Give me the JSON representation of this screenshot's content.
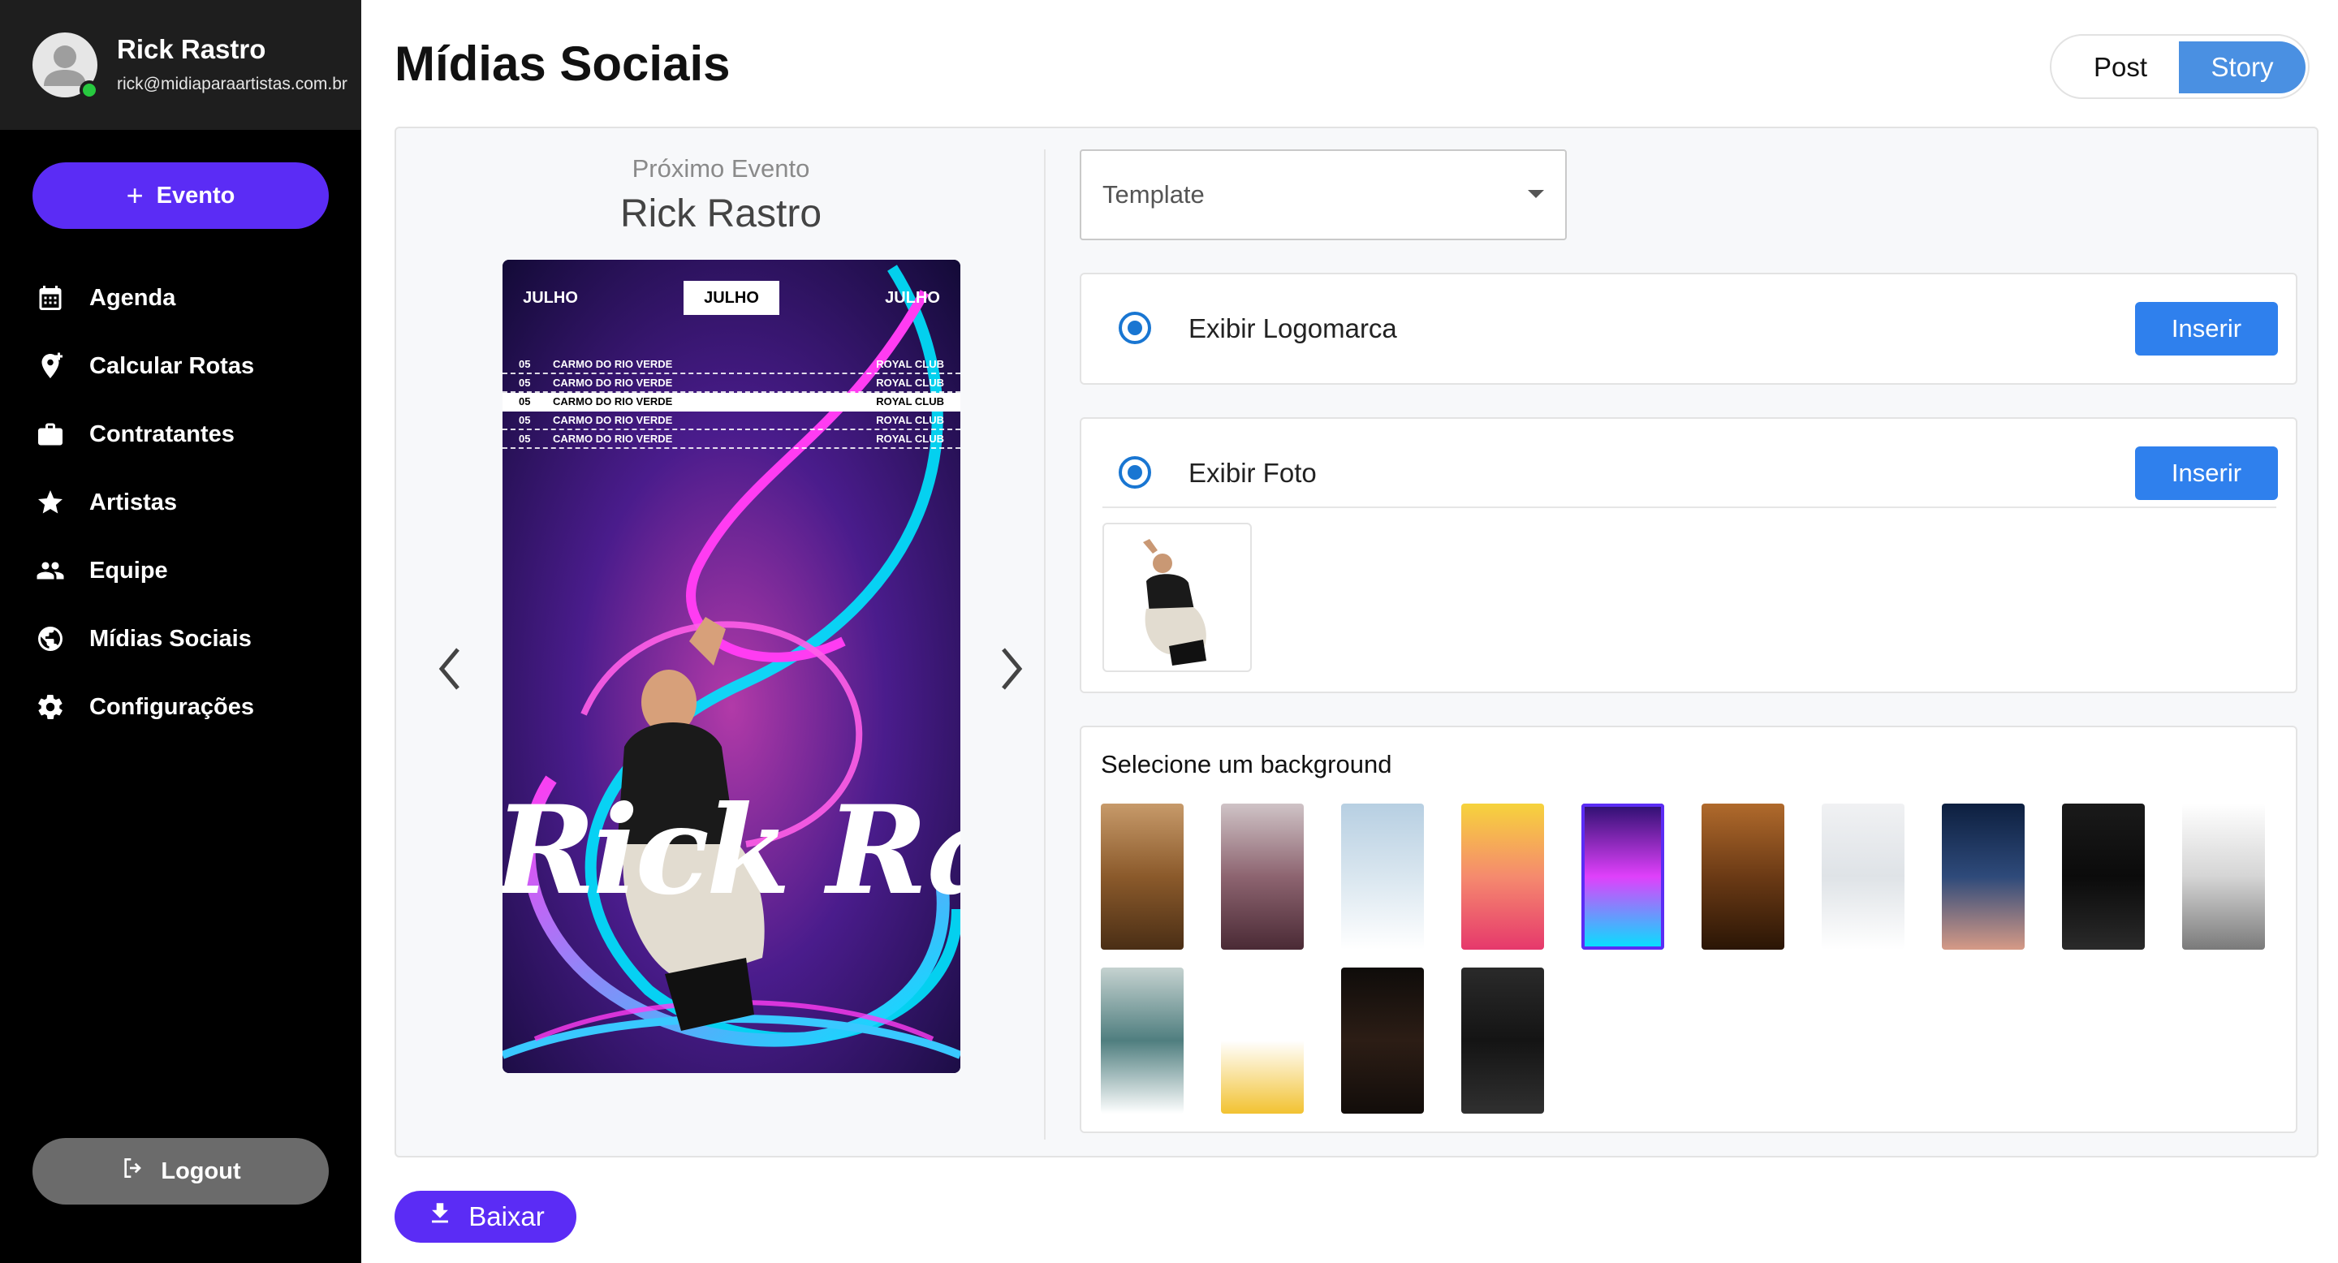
{
  "profile": {
    "name": "Rick Rastro",
    "email": "rick@midiaparaartistas.com.br",
    "status_color": "#27c93f"
  },
  "sidebar": {
    "event_button": {
      "icon": "plus-icon",
      "label": "Evento"
    },
    "items": [
      {
        "icon": "calendar-icon",
        "label": "Agenda"
      },
      {
        "icon": "location-plus-icon",
        "label": "Calcular Rotas"
      },
      {
        "icon": "briefcase-icon",
        "label": "Contratantes"
      },
      {
        "icon": "star-icon",
        "label": "Artistas"
      },
      {
        "icon": "people-icon",
        "label": "Equipe"
      },
      {
        "icon": "globe-icon",
        "label": "Mídias Sociais"
      },
      {
        "icon": "gear-icon",
        "label": "Configurações"
      }
    ],
    "logout_button": {
      "icon": "logout-icon",
      "label": "Logout"
    }
  },
  "header": {
    "title": "Mídias Sociais",
    "format_toggle": {
      "options": [
        "Post",
        "Story"
      ],
      "selected": "Story"
    }
  },
  "preview": {
    "subtitle": "Próximo Evento",
    "title": "Rick Rastro",
    "story": {
      "months": [
        "JULHO",
        "JULHO",
        "JULHO"
      ],
      "active_month_index": 1,
      "rows": [
        {
          "day": "05",
          "city": "CARMO DO RIO VERDE",
          "venue": "ROYAL CLUB"
        },
        {
          "day": "05",
          "city": "CARMO DO RIO VERDE",
          "venue": "ROYAL CLUB"
        },
        {
          "day": "05",
          "city": "CARMO DO RIO VERDE",
          "venue": "ROYAL CLUB"
        },
        {
          "day": "05",
          "city": "CARMO DO RIO VERDE",
          "venue": "ROYAL CLUB"
        },
        {
          "day": "05",
          "city": "CARMO DO RIO VERDE",
          "venue": "ROYAL CLUB"
        }
      ],
      "highlighted_row_index": 2,
      "artist_lettering": "Rick Rastro"
    }
  },
  "template_select": {
    "value": "Template"
  },
  "options": {
    "logo": {
      "label": "Exibir Logomarca",
      "checked": true,
      "button": "Inserir"
    },
    "photo": {
      "label": "Exibir Foto",
      "checked": true,
      "button": "Inserir"
    }
  },
  "backgrounds": {
    "heading": "Selecione um background",
    "selected_index": 4,
    "items": [
      {
        "name": "sand-desert",
        "colors": [
          "#c79a6a",
          "#8b5a2b",
          "#4a2e15"
        ]
      },
      {
        "name": "mauve-gradient",
        "colors": [
          "#cfc3c6",
          "#8d6470",
          "#4a2a35"
        ]
      },
      {
        "name": "sky-clouds",
        "colors": [
          "#b7cfe2",
          "#d9e6ef",
          "#ffffff"
        ]
      },
      {
        "name": "sunset-gradient",
        "colors": [
          "#f6d33c",
          "#f58a6e",
          "#e6386c"
        ]
      },
      {
        "name": "neon-swirl",
        "colors": [
          "#2a0f6e",
          "#e040fb",
          "#00e5ff"
        ]
      },
      {
        "name": "wood-planks",
        "colors": [
          "#b06a2c",
          "#6b3a15",
          "#2a1505"
        ]
      },
      {
        "name": "white-texture",
        "colors": [
          "#f0f1f3",
          "#dfe3e7",
          "#ffffff"
        ]
      },
      {
        "name": "night-sky",
        "colors": [
          "#0d1f3f",
          "#2e4a7a",
          "#d69a86"
        ]
      },
      {
        "name": "black-texture",
        "colors": [
          "#1a1a1a",
          "#0b0b0b",
          "#2a2a2a"
        ]
      },
      {
        "name": "grunge-white",
        "colors": [
          "#ffffff",
          "#d5d5d5",
          "#7a7a7a"
        ]
      },
      {
        "name": "mountain-lake",
        "colors": [
          "#c5d2d0",
          "#4f7e7f",
          "#ffffff"
        ]
      },
      {
        "name": "yellow-paint",
        "colors": [
          "#ffffff",
          "#ffffff",
          "#f2c231"
        ]
      },
      {
        "name": "dark-bokeh",
        "colors": [
          "#0f0c0a",
          "#2c1d15",
          "#120d0a"
        ]
      },
      {
        "name": "dark-wood",
        "colors": [
          "#2a2a2a",
          "#141414",
          "#303030"
        ]
      }
    ]
  },
  "download_button": {
    "icon": "download-icon",
    "label": "Baixar"
  },
  "accent_colors": {
    "primary": "#5b2cf5",
    "blue": "#2f80ed",
    "toggle": "#4a90e2"
  }
}
